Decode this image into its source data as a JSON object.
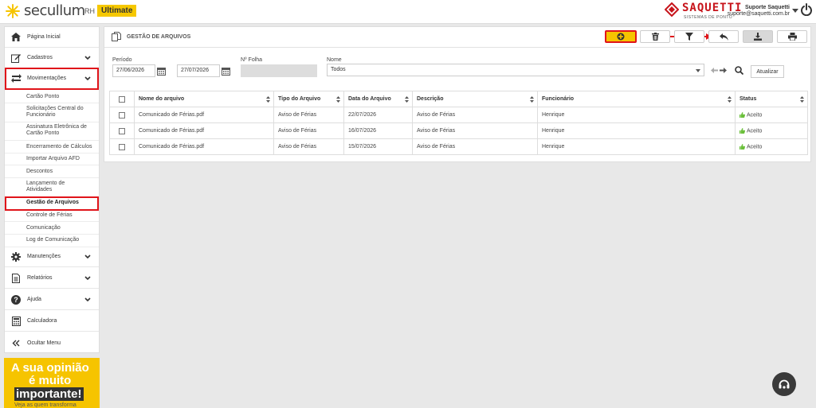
{
  "header": {
    "logo_text": "secullum",
    "logo_rh": "RH",
    "logo_badge": "Ultimate",
    "partner_name": "SAQUETTI",
    "partner_sub": "SISTEMAS DE PONTO",
    "user_name": "Suporte Saquetti",
    "user_email": "suporte@saquetti.com.br"
  },
  "sidebar": {
    "items": [
      {
        "label": "Página Inicial",
        "icon": "home-icon"
      },
      {
        "label": "Cadastros",
        "icon": "edit-icon"
      },
      {
        "label": "Movimentações",
        "icon": "exchange-icon"
      },
      {
        "label": "Manutenções",
        "icon": "gear-icon"
      },
      {
        "label": "Relatórios",
        "icon": "report-icon"
      },
      {
        "label": "Ajuda",
        "icon": "question-icon"
      },
      {
        "label": "Calculadora",
        "icon": "calculator-icon"
      },
      {
        "label": "Ocultar Menu",
        "icon": "double-chevron-left-icon"
      }
    ],
    "sub_items": [
      {
        "label": "Cartão Ponto"
      },
      {
        "label": "Solicitações Central do Funcionário"
      },
      {
        "label": "Assinatura Eletrônica de Cartão Ponto"
      },
      {
        "label": "Encerramento de Cálculos"
      },
      {
        "label": "Importar Arquivo AFD"
      },
      {
        "label": "Descontos"
      },
      {
        "label": "Lançamento de Atividades"
      },
      {
        "label": "Gestão de Arquivos"
      },
      {
        "label": "Controle de Férias"
      },
      {
        "label": "Comunicação"
      },
      {
        "label": "Log de Comunicação"
      }
    ]
  },
  "banner": {
    "line1": "A sua opinião",
    "line2": "é muito",
    "line3": "importante!",
    "line4": "Veja as quem transforma"
  },
  "panel": {
    "title": "GESTÃO DE ARQUIVOS"
  },
  "filters": {
    "period_label": "Período",
    "date_from": "27/06/2026",
    "date_to": "27/07/2026",
    "folha_label": "Nº Folha",
    "folha_value": "",
    "name_label": "Nome",
    "name_value": "Todos",
    "update_button": "Atualizar"
  },
  "table": {
    "columns": [
      "Nome do arquivo",
      "Tipo do Arquivo",
      "Data do Arquivo",
      "Descrição",
      "Funcionário",
      "Status"
    ],
    "rows": [
      [
        "Comunicado de Férias.pdf",
        "Aviso de Férias",
        "22/07/2026",
        "Aviso de Férias",
        "Henrique",
        "Aceito"
      ],
      [
        "Comunicado de Férias.pdf",
        "Aviso de Férias",
        "16/07/2026",
        "Aviso de Férias",
        "Henrique",
        "Aceito"
      ],
      [
        "Comunicado de Férias.pdf",
        "Aviso de Férias",
        "15/07/2026",
        "Aviso de Férias",
        "Henrique",
        "Aceito"
      ]
    ]
  },
  "colors": {
    "accent_yellow": "#f6c400",
    "highlight_red": "#e0141a",
    "status_green": "#6abf3a"
  }
}
